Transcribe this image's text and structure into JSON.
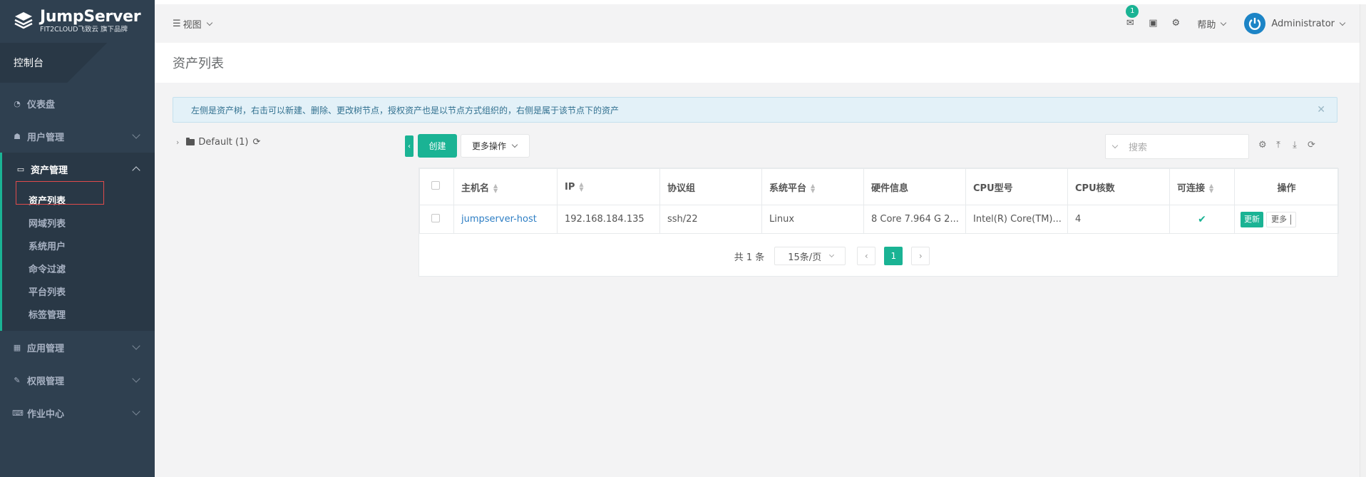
{
  "brand": {
    "title": "JumpServer",
    "subtitle": "FIT2CLOUD飞致云 旗下品牌"
  },
  "sidebar": {
    "console": "控制台",
    "items": [
      {
        "label": "仪表盘",
        "icon": "dashboard-icon"
      },
      {
        "label": "用户管理",
        "icon": "users-icon"
      },
      {
        "label": "资产管理",
        "icon": "inbox-icon"
      },
      {
        "label": "应用管理",
        "icon": "grid-icon"
      },
      {
        "label": "权限管理",
        "icon": "edit-icon"
      },
      {
        "label": "作业中心",
        "icon": "keyboard-icon"
      }
    ],
    "asset_sub": [
      "资产列表",
      "网域列表",
      "系统用户",
      "命令过滤",
      "平台列表",
      "标签管理"
    ]
  },
  "topbar": {
    "view": "视图",
    "mail_badge": "1",
    "help": "帮助",
    "user": "Administrator"
  },
  "page": {
    "title": "资产列表",
    "alert": "左侧是资产树，右击可以新建、删除、更改树节点，授权资产也是以节点方式组织的，右侧是属于该节点下的资产",
    "tree_node": "Default (1)",
    "create_label": "创建",
    "more_actions": "更多操作",
    "search_placeholder": "搜索"
  },
  "table": {
    "headers": [
      "主机名",
      "IP",
      "协议组",
      "系统平台",
      "硬件信息",
      "CPU型号",
      "CPU核数",
      "可连接",
      "操作"
    ],
    "rows": [
      {
        "hostname": "jumpserver-host",
        "ip": "192.168.184.135",
        "protocols": "ssh/22",
        "platform": "Linux",
        "hardware": "8 Core 7.964 G 2...",
        "cpu_model": "Intel(R) Core(TM)...",
        "cpu_cores": "4",
        "update_label": "更新",
        "more_label": "更多"
      }
    ]
  },
  "pagination": {
    "total": "共 1 条",
    "page_size": "15条/页",
    "current": "1"
  },
  "colors": {
    "sidebar": "#2f4050",
    "accent": "#1ab394",
    "link": "#2d7ec4"
  }
}
